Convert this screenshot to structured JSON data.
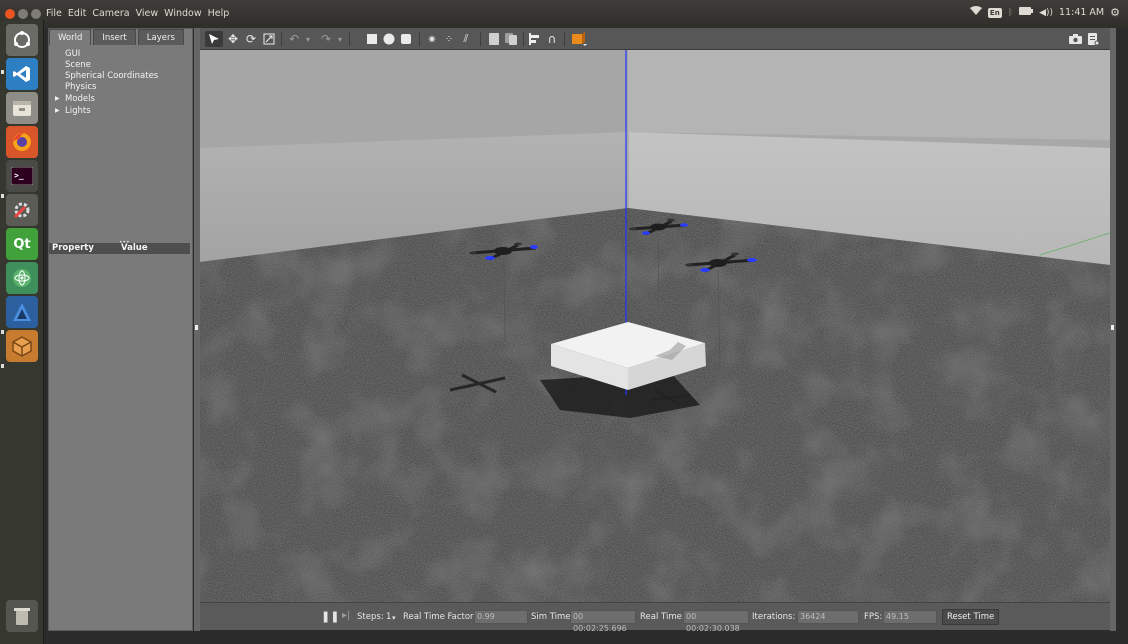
{
  "menubar": {
    "items": [
      "File",
      "Edit",
      "Camera",
      "View",
      "Window",
      "Help"
    ],
    "keyboard_layout": "En",
    "clock": "11:41 AM"
  },
  "launcher": {
    "apps": [
      "ubuntu-dash-icon",
      "vscode-icon",
      "files-icon",
      "firefox-icon",
      "terminal-icon",
      "system-settings-icon",
      "qt-creator-icon",
      "atom-icon",
      "gazebo-icon",
      "package-icon",
      "trash-icon"
    ]
  },
  "left_panel": {
    "tabs": [
      "World",
      "Insert",
      "Layers"
    ],
    "active_tab": "World",
    "tree": [
      {
        "label": "GUI",
        "expandable": false
      },
      {
        "label": "Scene",
        "expandable": false
      },
      {
        "label": "Spherical Coordinates",
        "expandable": false
      },
      {
        "label": "Physics",
        "expandable": false
      },
      {
        "label": "Models",
        "expandable": true
      },
      {
        "label": "Lights",
        "expandable": true
      }
    ],
    "property_header": "Property",
    "value_header": "Value"
  },
  "toolbar": {
    "tools": [
      "select-icon",
      "translate-icon",
      "rotate-icon",
      "scale-icon",
      "undo-icon",
      "redo-icon",
      "box-icon",
      "sphere-icon",
      "cylinder-icon",
      "point-light-icon",
      "spot-light-icon",
      "directional-light-icon",
      "copy-icon",
      "paste-icon",
      "align-icon",
      "snap-icon",
      "view-angle-icon"
    ],
    "right_tools": [
      "screenshot-icon",
      "log-icon"
    ]
  },
  "status": {
    "steps_label": "Steps:",
    "steps_value": "1",
    "real_time_factor_label": "Real Time Factor:",
    "real_time_factor": "0.99",
    "sim_time_label": "Sim Time:",
    "sim_time": "00 00:02:25.696",
    "real_time_label": "Real Time:",
    "real_time": "00 00:02:30.038",
    "iterations_label": "Iterations:",
    "iterations": "36424",
    "fps_label": "FPS:",
    "fps": "49.15",
    "reset_button": "Reset Time"
  },
  "colors": {
    "accent_orange": "#e95420",
    "axis_blue": "#2233ff",
    "drone_blue": "#2a3cff"
  }
}
